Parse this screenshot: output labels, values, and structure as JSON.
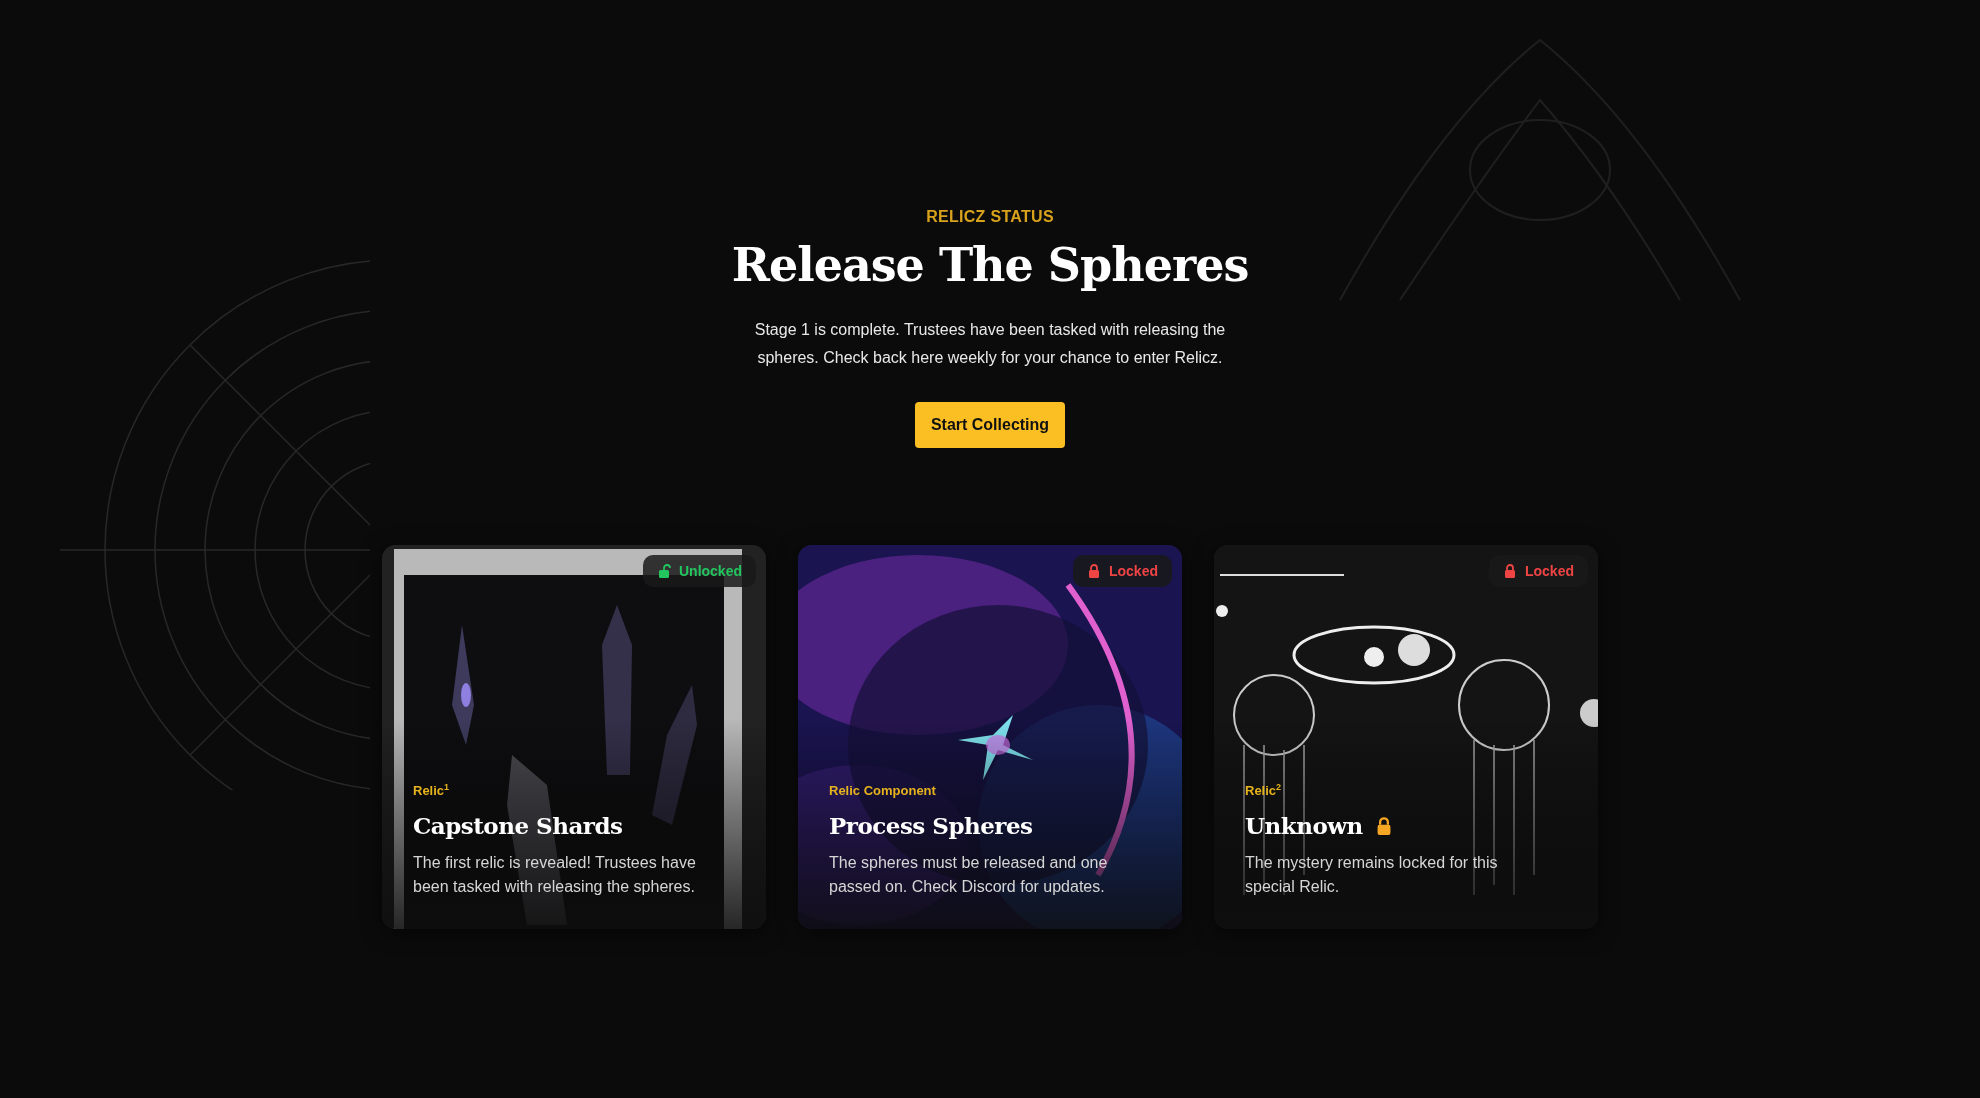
{
  "header": {
    "eyebrow": "RELICZ STATUS",
    "title": "Release The Spheres",
    "description": "Stage 1 is complete. Trustees have been tasked with releasing the spheres. Check back here weekly for your chance to enter Relicz.",
    "button": "Start Collecting"
  },
  "cards": [
    {
      "category": "Relic$^{1}$",
      "title": "Capstone Shards",
      "title_locked": false,
      "description": "The first relic is revealed! Trustees have been tasked with releasing the spheres.",
      "status": {
        "label": "Unlocked",
        "unlocked": true
      }
    },
    {
      "category": "Relic Component",
      "title": "Process Spheres",
      "title_locked": false,
      "description": "The spheres must be released and one passed on. Check Discord for updates.",
      "status": {
        "label": "Locked",
        "unlocked": false
      }
    },
    {
      "category": "Relic$^{2}$",
      "title": "Unknown",
      "title_locked": true,
      "description": "The mystery remains locked for this special Relic.",
      "status": {
        "label": "Locked",
        "unlocked": false
      }
    }
  ]
}
